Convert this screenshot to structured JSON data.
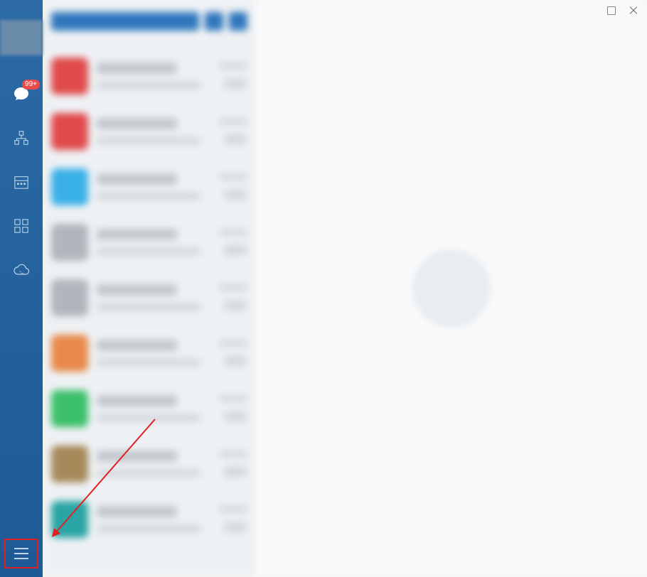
{
  "sidebar": {
    "chat_badge": "99+"
  },
  "chat_list": {
    "items": [
      {
        "avatar_color": "red"
      },
      {
        "avatar_color": "red"
      },
      {
        "avatar_color": "blue"
      },
      {
        "avatar_color": "gray"
      },
      {
        "avatar_color": "gray"
      },
      {
        "avatar_color": "orange"
      },
      {
        "avatar_color": "green"
      },
      {
        "avatar_color": "brown"
      },
      {
        "avatar_color": "teal"
      }
    ]
  }
}
